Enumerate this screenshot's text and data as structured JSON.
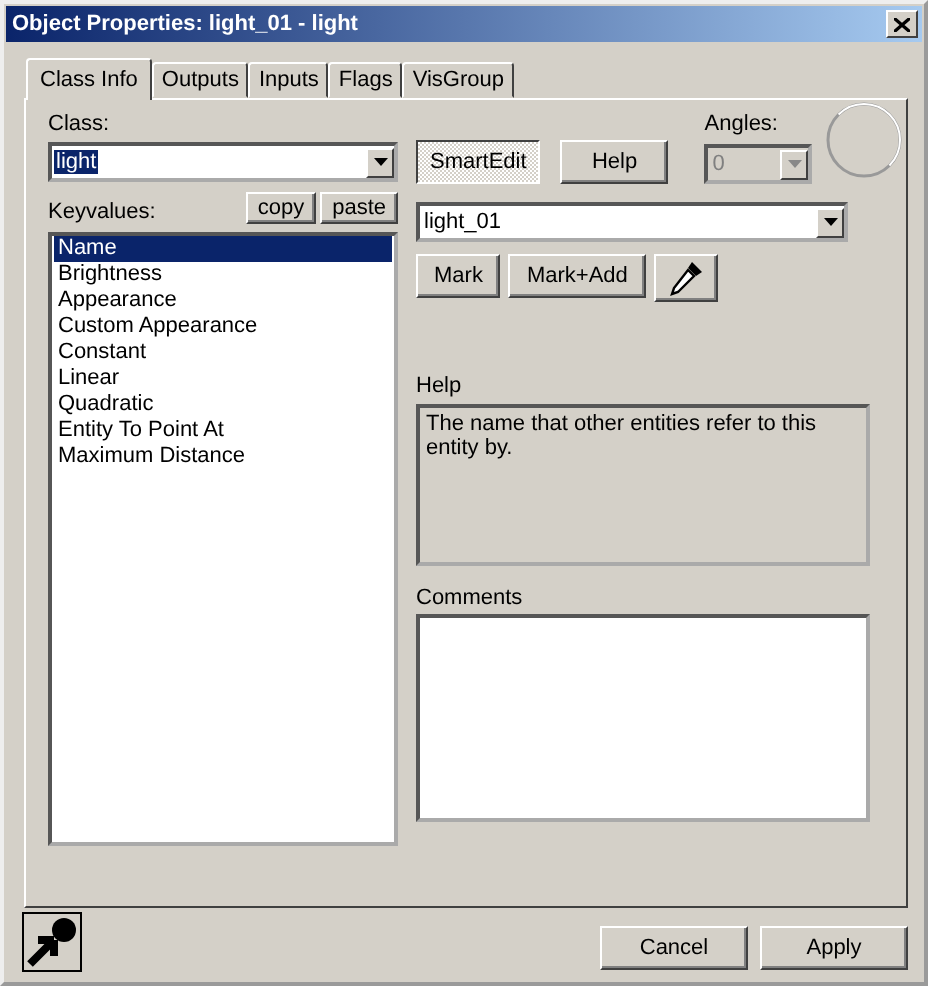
{
  "window": {
    "title": "Object Properties: light_01 - light"
  },
  "tabs": [
    {
      "label": "Class Info",
      "selected": true
    },
    {
      "label": "Outputs",
      "selected": false
    },
    {
      "label": "Inputs",
      "selected": false
    },
    {
      "label": "Flags",
      "selected": false
    },
    {
      "label": "VisGroup",
      "selected": false
    }
  ],
  "class": {
    "label": "Class:",
    "value": "light",
    "text_selected": true
  },
  "smartedit": {
    "label": "SmartEdit",
    "pressed": true
  },
  "help_button": "Help",
  "angles": {
    "label": "Angles:",
    "value": "0",
    "disabled": true
  },
  "keyvalues": {
    "label": "Keyvalues:",
    "copy": "copy",
    "paste": "paste",
    "items": [
      {
        "label": "Name",
        "selected": true
      },
      {
        "label": "Brightness",
        "selected": false
      },
      {
        "label": "Appearance",
        "selected": false
      },
      {
        "label": "Custom Appearance",
        "selected": false
      },
      {
        "label": "Constant",
        "selected": false
      },
      {
        "label": "Linear",
        "selected": false
      },
      {
        "label": "Quadratic",
        "selected": false
      },
      {
        "label": "Entity To Point At",
        "selected": false
      },
      {
        "label": "Maximum Distance",
        "selected": false
      }
    ]
  },
  "value": "light_01",
  "mark_buttons": [
    "Mark",
    "Mark+Add"
  ],
  "help": {
    "label": "Help",
    "text": "The name that other entities refer to this entity by."
  },
  "comments": {
    "label": "Comments"
  },
  "buttons": [
    "Cancel",
    "Apply"
  ]
}
